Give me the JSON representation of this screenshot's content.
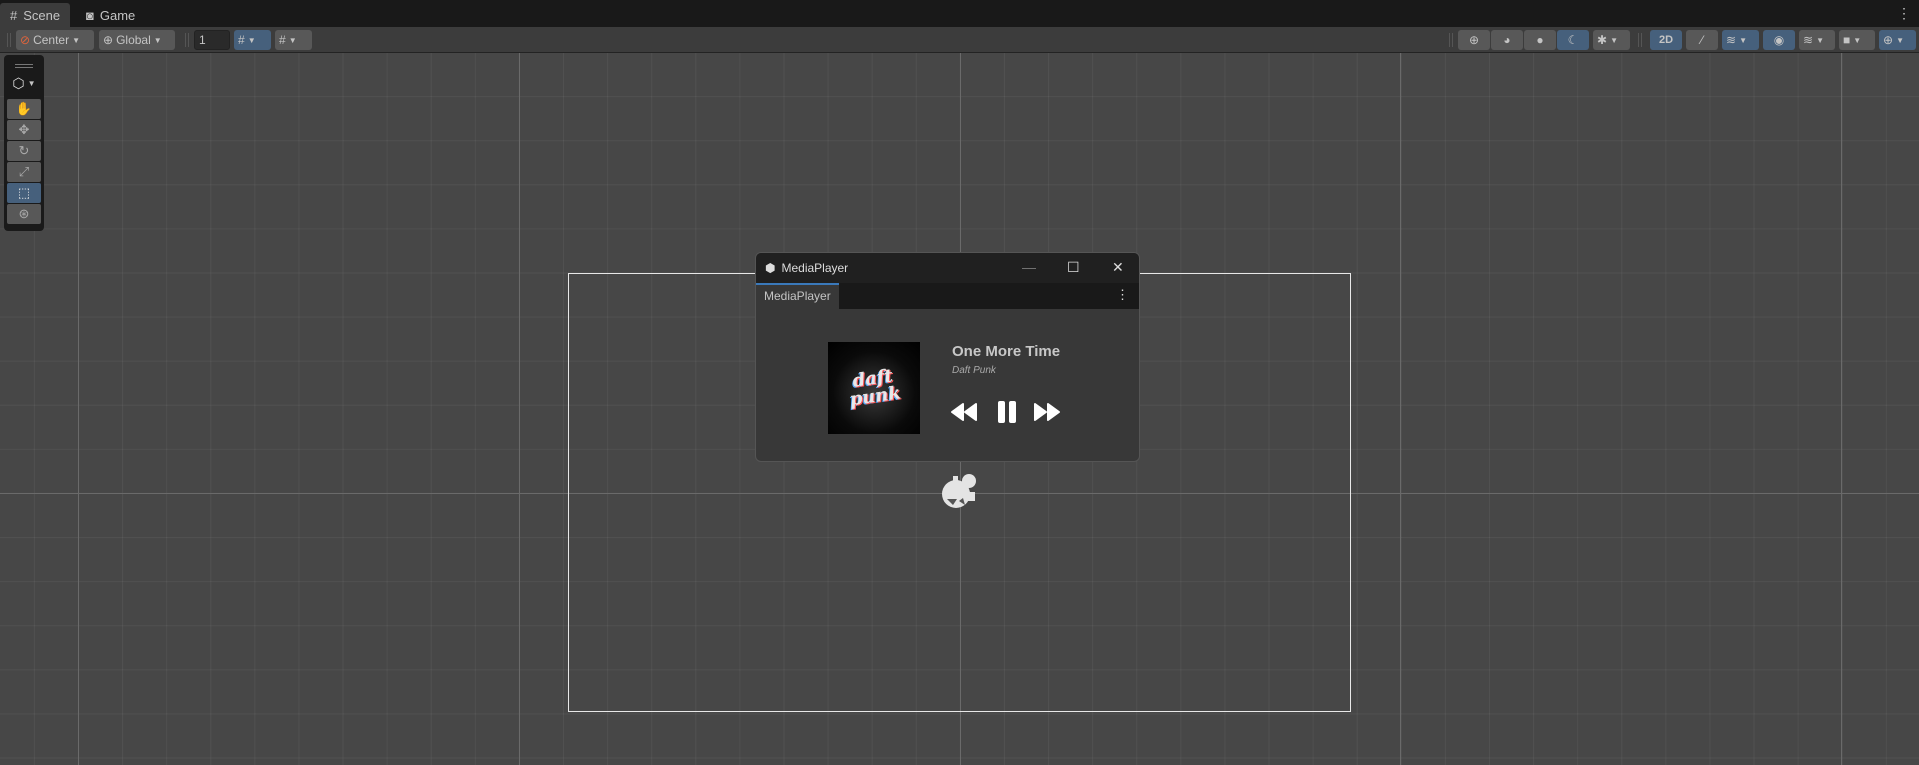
{
  "tabs": [
    {
      "label": "Scene",
      "icon": "grid-icon",
      "active": true
    },
    {
      "label": "Game",
      "icon": "gamepad-icon",
      "active": false
    }
  ],
  "toolbar": {
    "pivot": "Center",
    "space": "Global",
    "grid_size": "1"
  },
  "right_toolbar": {
    "mode_2d": "2D"
  },
  "media_window": {
    "title": "MediaPlayer",
    "tab": "MediaPlayer",
    "song": "One More Time",
    "artist": "Daft Punk",
    "album_art_text": "daft punk",
    "state": "playing"
  },
  "colors": {
    "accent": "#46607c",
    "scene_bg": "#474747",
    "tab_accent": "#3a79bb"
  }
}
